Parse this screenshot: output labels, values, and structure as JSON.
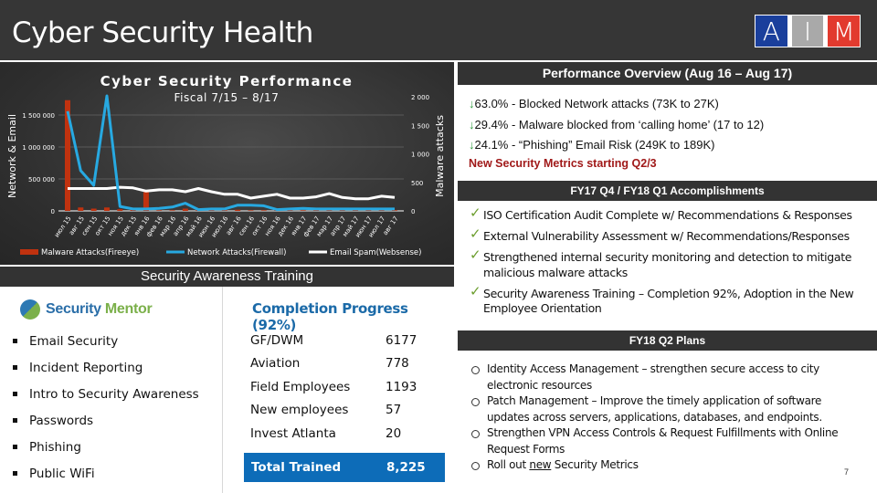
{
  "header": {
    "title": "Cyber Security Health",
    "logo_letters": [
      "A",
      "I",
      "M"
    ],
    "logo_colors": [
      "#1a3f9c",
      "#a9a9a9",
      "#e23a2e"
    ]
  },
  "chart_data": {
    "type": "bar+line",
    "title": "Cyber Security Performance",
    "subtitle": "Fiscal 7/15 – 8/17",
    "ylabel_left": "Network & Email",
    "ylabel_right": "Malware attacks",
    "ylim_left": [
      0,
      1500000
    ],
    "ylim_right": [
      0,
      2000
    ],
    "yticks_left": [
      "0",
      "500 000",
      "1 000 000",
      "1 500 000"
    ],
    "yticks_right": [
      "0",
      "500",
      "1 000",
      "1 500",
      "2 000"
    ],
    "grid": true,
    "legend_position": "bottom",
    "categories": [
      "июл 15",
      "авг 15",
      "сен 15",
      "окт 15",
      "ноя 15",
      "дек 15",
      "янв 16",
      "фев 16",
      "мар 16",
      "апр 16",
      "май 16",
      "июн 16",
      "июл 16",
      "авг 16",
      "сен 16",
      "окт 16",
      "ноя 16",
      "дек 16",
      "янв 17",
      "фев 17",
      "мар 17",
      "апр 17",
      "май 17",
      "июн 17",
      "июл 17",
      "авг 17"
    ],
    "series": [
      {
        "name": "Malware Attacks(Fireeye)",
        "type": "bar",
        "axis": "right",
        "color": "#c0320f",
        "values": [
          1940,
          60,
          40,
          60,
          30,
          20,
          330,
          10,
          10,
          40,
          15,
          10,
          10,
          20,
          10,
          10,
          10,
          10,
          10,
          10,
          10,
          10,
          10,
          10,
          10,
          10
        ]
      },
      {
        "name": "Network Attacks(Firewall)",
        "type": "line",
        "axis": "left",
        "color": "#27a9e1",
        "values": [
          1560000,
          630000,
          400000,
          1800000,
          70000,
          30000,
          30000,
          40000,
          60000,
          120000,
          20000,
          30000,
          30000,
          90000,
          90000,
          80000,
          20000,
          30000,
          40000,
          30000,
          30000,
          30000,
          30000,
          30000,
          30000,
          30000
        ]
      },
      {
        "name": "Email Spam(Websense)",
        "type": "line",
        "axis": "left",
        "color": "#ffffff",
        "values": [
          350000,
          350000,
          350000,
          350000,
          370000,
          360000,
          310000,
          330000,
          330000,
          300000,
          350000,
          300000,
          260000,
          260000,
          200000,
          230000,
          260000,
          200000,
          200000,
          220000,
          270000,
          210000,
          190000,
          190000,
          230000,
          210000
        ]
      }
    ]
  },
  "training": {
    "section_title": "Security Awareness Training",
    "vendor": {
      "name_part1": "Security",
      "name_part2": "Mentor"
    },
    "courses": [
      "Email Security",
      "Incident Reporting",
      "Intro to Security Awareness",
      "Passwords",
      "Phishing",
      "Public WiFi"
    ],
    "completion_title": "Completion Progress (92%)",
    "completion_percent": 92,
    "groups": [
      {
        "name": "GF/DWM",
        "count": "6177"
      },
      {
        "name": "Aviation",
        "count": "778"
      },
      {
        "name": "Field Employees",
        "count": "1193"
      },
      {
        "name": "New employees",
        "count": "57"
      },
      {
        "name": "Invest Atlanta",
        "count": "20"
      }
    ],
    "total": {
      "label": "Total Trained",
      "value": "8,225"
    }
  },
  "overview": {
    "title": "Performance Overview (Aug 16 – Aug 17)",
    "arrow": "↓",
    "metrics": [
      "63.0% - Blocked Network attacks (73K to 27K)",
      "29.4% - Malware blocked from ‘calling home’ (17 to 12)",
      "24.1% - “Phishing” Email Risk (249K to 189K)"
    ],
    "new_metrics_note": "New Security Metrics starting Q2/3",
    "accent_green": "#2e9a3e",
    "accent_red": "#a01919"
  },
  "accomplishments": {
    "title": "FY17 Q4 / FY18 Q1 Accomplishments",
    "check": "✓",
    "items": [
      "ISO Certification Audit Complete w/ Recommendations & Responses",
      "External Vulnerability Assessment w/  Recommendations/Responses",
      "Strengthened internal security monitoring and detection to mitigate malicious malware attacks",
      "Security Awareness Training – Completion 92%, Adoption in the New Employee Orientation"
    ]
  },
  "plans": {
    "title": "FY18 Q2 Plans",
    "items": [
      "Identity Access Management – strengthen secure access to city electronic resources",
      "Patch Management – Improve the timely application of software updates across servers, applications, databases, and endpoints.",
      "Strengthen VPN Access Controls & Request Fulfillments with Online Request Forms"
    ],
    "last_item": {
      "prefix": "Roll out ",
      "underlined": "new",
      "suffix": " Security Metrics"
    }
  },
  "page_number": "7"
}
